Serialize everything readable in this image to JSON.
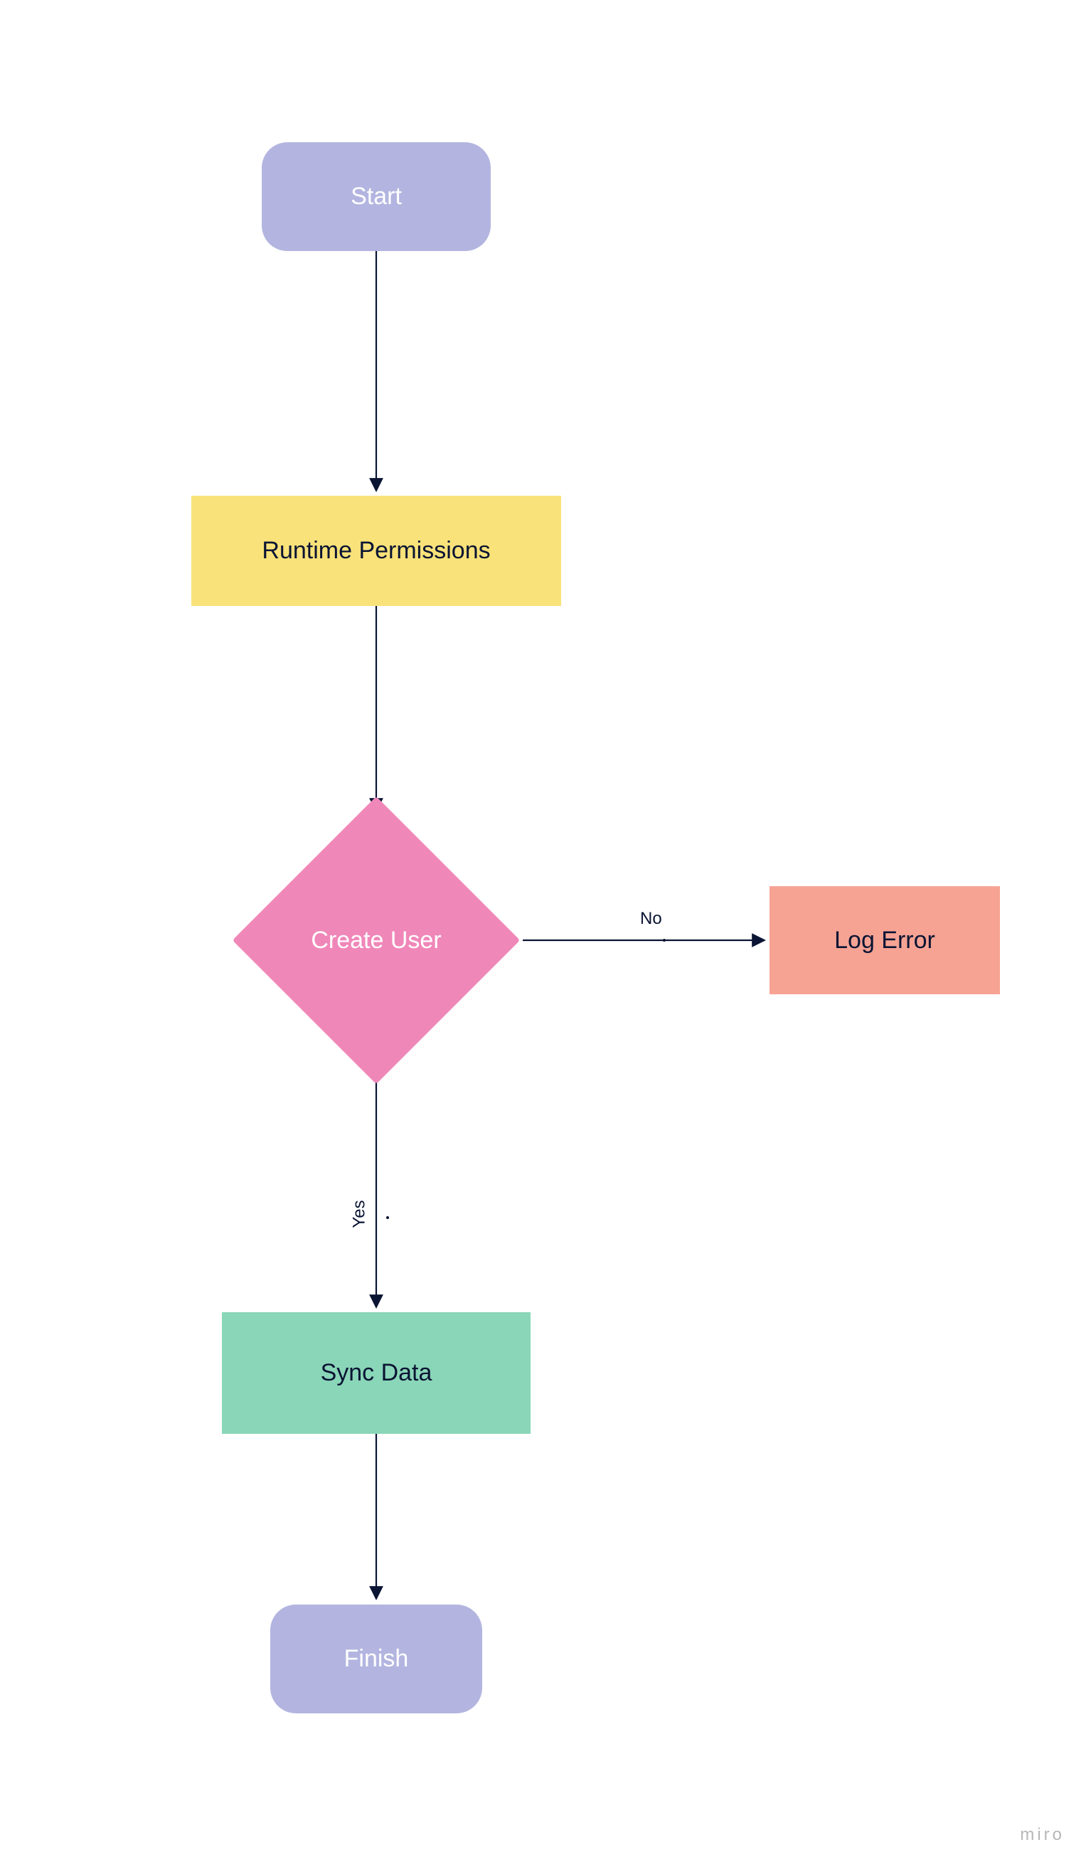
{
  "nodes": {
    "start": {
      "label": "Start",
      "fill": "#b3b5e0"
    },
    "runtime": {
      "label": "Runtime Permissions",
      "fill": "#fae27a"
    },
    "create": {
      "label": "Create User",
      "fill": "#f087b9"
    },
    "logerr": {
      "label": "Log Error",
      "fill": "#f6a394"
    },
    "sync": {
      "label": "Sync Data",
      "fill": "#8ad6b8"
    },
    "finish": {
      "label": "Finish",
      "fill": "#b3b5e0"
    }
  },
  "edges": {
    "no": {
      "label": "No"
    },
    "yes": {
      "label": "Yes"
    }
  },
  "watermark": "miro"
}
